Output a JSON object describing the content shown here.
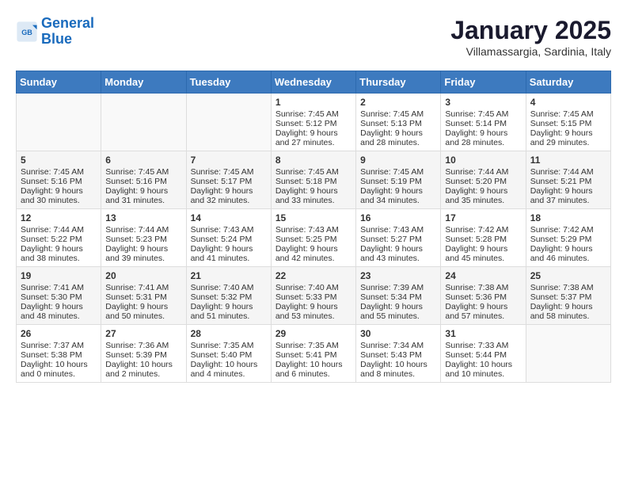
{
  "header": {
    "logo_line1": "General",
    "logo_line2": "Blue",
    "month": "January 2025",
    "location": "Villamassargia, Sardinia, Italy"
  },
  "weekdays": [
    "Sunday",
    "Monday",
    "Tuesday",
    "Wednesday",
    "Thursday",
    "Friday",
    "Saturday"
  ],
  "weeks": [
    [
      {
        "day": "",
        "info": ""
      },
      {
        "day": "",
        "info": ""
      },
      {
        "day": "",
        "info": ""
      },
      {
        "day": "1",
        "info": "Sunrise: 7:45 AM\nSunset: 5:12 PM\nDaylight: 9 hours and 27 minutes."
      },
      {
        "day": "2",
        "info": "Sunrise: 7:45 AM\nSunset: 5:13 PM\nDaylight: 9 hours and 28 minutes."
      },
      {
        "day": "3",
        "info": "Sunrise: 7:45 AM\nSunset: 5:14 PM\nDaylight: 9 hours and 28 minutes."
      },
      {
        "day": "4",
        "info": "Sunrise: 7:45 AM\nSunset: 5:15 PM\nDaylight: 9 hours and 29 minutes."
      }
    ],
    [
      {
        "day": "5",
        "info": "Sunrise: 7:45 AM\nSunset: 5:16 PM\nDaylight: 9 hours and 30 minutes."
      },
      {
        "day": "6",
        "info": "Sunrise: 7:45 AM\nSunset: 5:16 PM\nDaylight: 9 hours and 31 minutes."
      },
      {
        "day": "7",
        "info": "Sunrise: 7:45 AM\nSunset: 5:17 PM\nDaylight: 9 hours and 32 minutes."
      },
      {
        "day": "8",
        "info": "Sunrise: 7:45 AM\nSunset: 5:18 PM\nDaylight: 9 hours and 33 minutes."
      },
      {
        "day": "9",
        "info": "Sunrise: 7:45 AM\nSunset: 5:19 PM\nDaylight: 9 hours and 34 minutes."
      },
      {
        "day": "10",
        "info": "Sunrise: 7:44 AM\nSunset: 5:20 PM\nDaylight: 9 hours and 35 minutes."
      },
      {
        "day": "11",
        "info": "Sunrise: 7:44 AM\nSunset: 5:21 PM\nDaylight: 9 hours and 37 minutes."
      }
    ],
    [
      {
        "day": "12",
        "info": "Sunrise: 7:44 AM\nSunset: 5:22 PM\nDaylight: 9 hours and 38 minutes."
      },
      {
        "day": "13",
        "info": "Sunrise: 7:44 AM\nSunset: 5:23 PM\nDaylight: 9 hours and 39 minutes."
      },
      {
        "day": "14",
        "info": "Sunrise: 7:43 AM\nSunset: 5:24 PM\nDaylight: 9 hours and 41 minutes."
      },
      {
        "day": "15",
        "info": "Sunrise: 7:43 AM\nSunset: 5:25 PM\nDaylight: 9 hours and 42 minutes."
      },
      {
        "day": "16",
        "info": "Sunrise: 7:43 AM\nSunset: 5:27 PM\nDaylight: 9 hours and 43 minutes."
      },
      {
        "day": "17",
        "info": "Sunrise: 7:42 AM\nSunset: 5:28 PM\nDaylight: 9 hours and 45 minutes."
      },
      {
        "day": "18",
        "info": "Sunrise: 7:42 AM\nSunset: 5:29 PM\nDaylight: 9 hours and 46 minutes."
      }
    ],
    [
      {
        "day": "19",
        "info": "Sunrise: 7:41 AM\nSunset: 5:30 PM\nDaylight: 9 hours and 48 minutes."
      },
      {
        "day": "20",
        "info": "Sunrise: 7:41 AM\nSunset: 5:31 PM\nDaylight: 9 hours and 50 minutes."
      },
      {
        "day": "21",
        "info": "Sunrise: 7:40 AM\nSunset: 5:32 PM\nDaylight: 9 hours and 51 minutes."
      },
      {
        "day": "22",
        "info": "Sunrise: 7:40 AM\nSunset: 5:33 PM\nDaylight: 9 hours and 53 minutes."
      },
      {
        "day": "23",
        "info": "Sunrise: 7:39 AM\nSunset: 5:34 PM\nDaylight: 9 hours and 55 minutes."
      },
      {
        "day": "24",
        "info": "Sunrise: 7:38 AM\nSunset: 5:36 PM\nDaylight: 9 hours and 57 minutes."
      },
      {
        "day": "25",
        "info": "Sunrise: 7:38 AM\nSunset: 5:37 PM\nDaylight: 9 hours and 58 minutes."
      }
    ],
    [
      {
        "day": "26",
        "info": "Sunrise: 7:37 AM\nSunset: 5:38 PM\nDaylight: 10 hours and 0 minutes."
      },
      {
        "day": "27",
        "info": "Sunrise: 7:36 AM\nSunset: 5:39 PM\nDaylight: 10 hours and 2 minutes."
      },
      {
        "day": "28",
        "info": "Sunrise: 7:35 AM\nSunset: 5:40 PM\nDaylight: 10 hours and 4 minutes."
      },
      {
        "day": "29",
        "info": "Sunrise: 7:35 AM\nSunset: 5:41 PM\nDaylight: 10 hours and 6 minutes."
      },
      {
        "day": "30",
        "info": "Sunrise: 7:34 AM\nSunset: 5:43 PM\nDaylight: 10 hours and 8 minutes."
      },
      {
        "day": "31",
        "info": "Sunrise: 7:33 AM\nSunset: 5:44 PM\nDaylight: 10 hours and 10 minutes."
      },
      {
        "day": "",
        "info": ""
      }
    ]
  ]
}
